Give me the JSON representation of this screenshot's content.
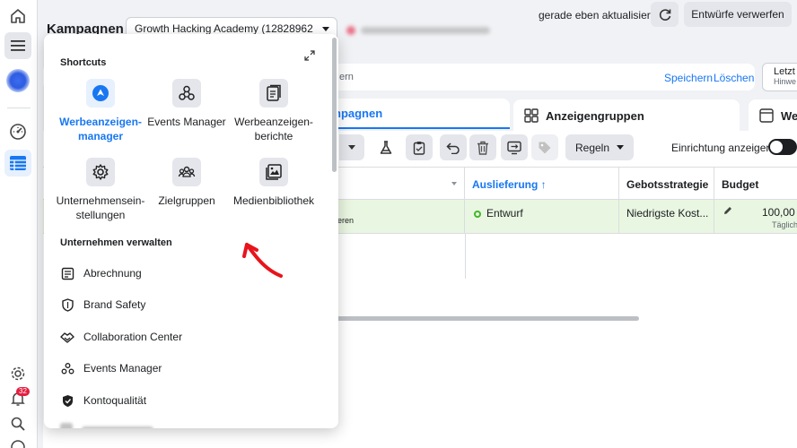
{
  "rail": {
    "items": [
      "home-icon",
      "menu-icon",
      "account-avatar",
      "dashboard-icon",
      "campaigns-table-icon",
      "settings-icon",
      "notifications-icon",
      "search-icon",
      "help-icon"
    ],
    "notification_count": "32"
  },
  "header": {
    "title": "Kampagnen",
    "account": "Growth Hacking Academy (12828962",
    "updated_text": "gerade eben aktualisiert",
    "discard_label": "Entwürfe verwerfen"
  },
  "search": {
    "text_fragment": "ern",
    "save_label": "Speichern",
    "delete_label": "Löschen",
    "last_label": "Letzt",
    "last_hint": "Hinwe"
  },
  "tabs": [
    {
      "label": "npagnen",
      "active": true
    },
    {
      "label": "Anzeigengruppen",
      "active": false
    },
    {
      "label": "Wer",
      "active": false
    }
  ],
  "toolbar": {
    "rules_label": "Regeln",
    "setup_label": "Einrichtung anzeigen"
  },
  "table": {
    "headers": [
      "",
      "Auslieferung ↑",
      "Gebotsstrategie",
      "Budget"
    ],
    "row": {
      "name_fragment": "eren",
      "delivery": "Entwurf",
      "bid_strategy": "Niedrigste Kost...",
      "budget": "100,00 €",
      "budget_period": "Täglich"
    }
  },
  "popup": {
    "shortcuts_heading": "Shortcuts",
    "shortcuts": [
      {
        "label": "Werbeanzeigen-manager",
        "icon": "ads-manager-icon",
        "active": true
      },
      {
        "label": "Events Manager",
        "icon": "events-manager-icon",
        "active": false
      },
      {
        "label": "Werbeanzeigen-berichte",
        "icon": "reports-icon",
        "active": false
      },
      {
        "label": "Unternehmensein-stellungen",
        "icon": "gear-icon",
        "active": false
      },
      {
        "label": "Zielgruppen",
        "icon": "audiences-icon",
        "active": false
      },
      {
        "label": "Medienbibliothek",
        "icon": "media-library-icon",
        "active": false
      }
    ],
    "manage_heading": "Unternehmen verwalten",
    "manage_items": [
      {
        "label": "Abrechnung",
        "icon": "billing-icon"
      },
      {
        "label": "Brand Safety",
        "icon": "shield-icon"
      },
      {
        "label": "Collaboration Center",
        "icon": "handshake-icon"
      },
      {
        "label": "Events Manager",
        "icon": "events-manager-icon"
      },
      {
        "label": "Kontoqualität",
        "icon": "account-quality-icon"
      }
    ]
  },
  "colors": {
    "accent": "#1877f2",
    "draft_row": "#e9f6e1",
    "annotation": "#e8141c"
  }
}
